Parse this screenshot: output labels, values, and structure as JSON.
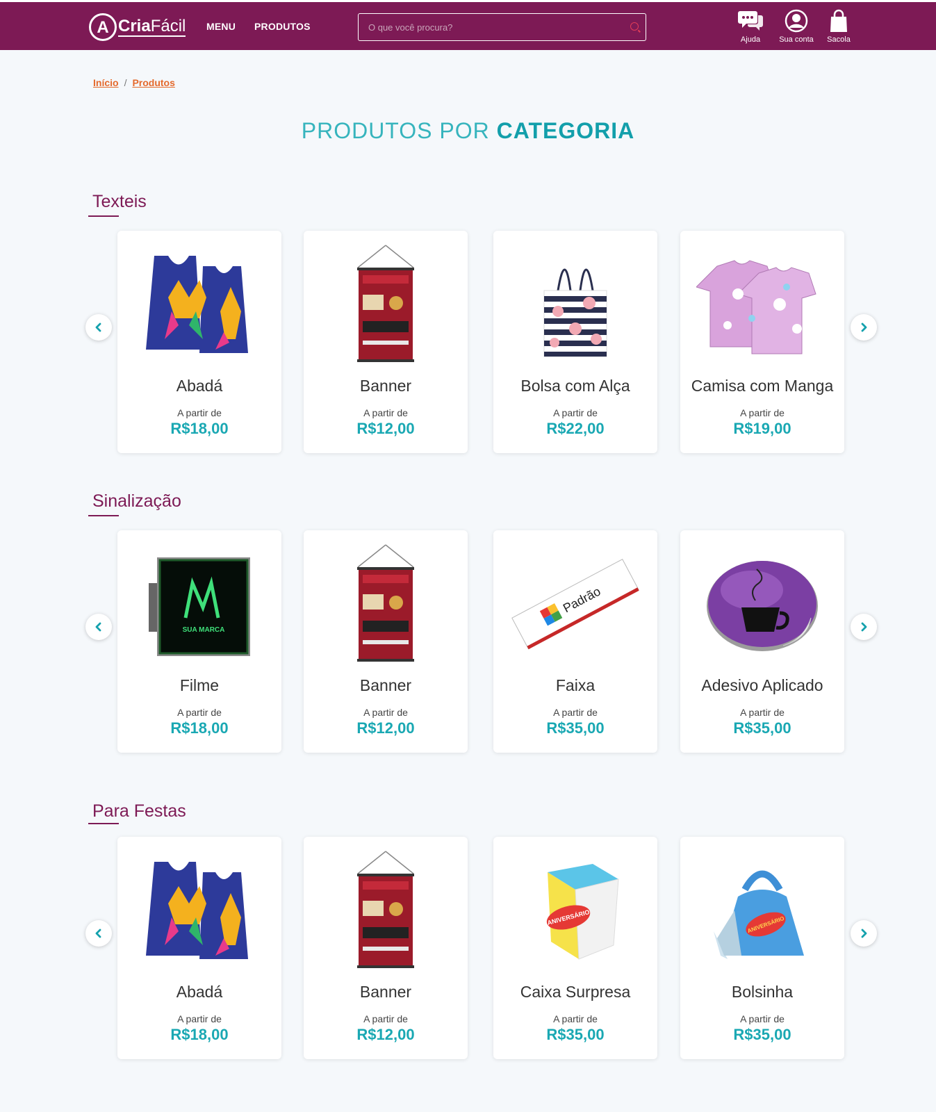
{
  "brand": {
    "logo_letter": "A",
    "logo_text_bold": "Cria",
    "logo_text_light": "Fácil"
  },
  "nav": {
    "menu": "MENU",
    "produtos": "PRODUTOS"
  },
  "search": {
    "placeholder": "O que você procura?"
  },
  "header_actions": {
    "ajuda": "Ajuda",
    "conta": "Sua conta",
    "sacola": "Sacola"
  },
  "breadcrumb": {
    "inicio": "Início",
    "separator": "/",
    "produtos": "Produtos"
  },
  "page_title": {
    "light": "PRODUTOS POR",
    "bold": "CATEGORIA"
  },
  "categories": [
    {
      "title": "Texteis",
      "products": [
        {
          "name": "Abadá",
          "from": "A partir de",
          "price": "R$18,00",
          "icon": "abada-image"
        },
        {
          "name": "Banner",
          "from": "A partir de",
          "price": "R$12,00",
          "icon": "banner-image"
        },
        {
          "name": "Bolsa com Alça",
          "from": "A partir de",
          "price": "R$22,00",
          "icon": "bag-image"
        },
        {
          "name": "Camisa com Manga",
          "from": "A partir de",
          "price": "R$19,00",
          "icon": "shirt-image"
        }
      ]
    },
    {
      "title": "Sinalização",
      "products": [
        {
          "name": "Filme",
          "from": "A partir de",
          "price": "R$18,00",
          "icon": "backlight-image"
        },
        {
          "name": "Banner",
          "from": "A partir de",
          "price": "R$12,00",
          "icon": "banner-image"
        },
        {
          "name": "Faixa",
          "from": "A partir de",
          "price": "R$35,00",
          "icon": "faixa-image"
        },
        {
          "name": "Adesivo Aplicado",
          "from": "A partir de",
          "price": "R$35,00",
          "icon": "sticker-image"
        }
      ]
    },
    {
      "title": "Para Festas",
      "products": [
        {
          "name": "Abadá",
          "from": "A partir de",
          "price": "R$18,00",
          "icon": "abada-image"
        },
        {
          "name": "Banner",
          "from": "A partir de",
          "price": "R$12,00",
          "icon": "banner-image"
        },
        {
          "name": "Caixa Surpresa",
          "from": "A partir de",
          "price": "R$35,00",
          "icon": "gift-box-image"
        },
        {
          "name": "Bolsinha",
          "from": "A partir de",
          "price": "R$35,00",
          "icon": "party-bag-image"
        }
      ]
    }
  ],
  "colors": {
    "primary": "#7d1a55",
    "accent": "#1aa8b3",
    "link": "#e46a2c"
  }
}
